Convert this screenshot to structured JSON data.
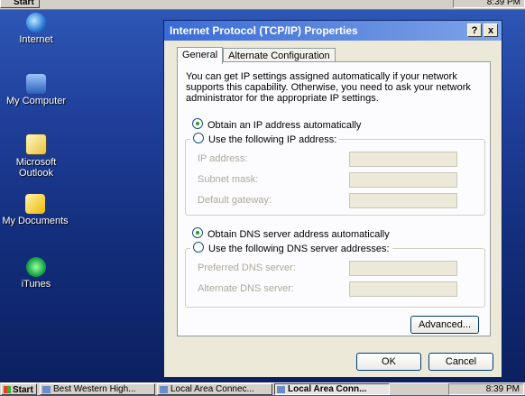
{
  "top_taskbar": {
    "start_label": "Start",
    "clock": "8:39 PM"
  },
  "desktop": {
    "icons": [
      {
        "label": "Internet"
      },
      {
        "label": "My Computer"
      },
      {
        "label": "Microsoft Outlook"
      },
      {
        "label": "My Documents"
      },
      {
        "label": "iTunes"
      }
    ]
  },
  "dialog": {
    "title": "Internet Protocol (TCP/IP) Properties",
    "help_button": "?",
    "close_button": "x",
    "tabs": [
      {
        "label": "General",
        "active": true
      },
      {
        "label": "Alternate Configuration",
        "active": false
      }
    ],
    "intro_text": "You can get IP settings assigned automatically if your network supports this capability. Otherwise, you need to ask your network administrator for the appropriate IP settings.",
    "ip": {
      "auto_label": "Obtain an IP address automatically",
      "auto_selected": true,
      "manual_label": "Use the following IP address:",
      "fields": [
        {
          "label": "IP address:",
          "value": ""
        },
        {
          "label": "Subnet mask:",
          "value": ""
        },
        {
          "label": "Default gateway:",
          "value": ""
        }
      ]
    },
    "dns": {
      "auto_label": "Obtain DNS server address automatically",
      "auto_selected": true,
      "manual_label": "Use the following DNS server addresses:",
      "fields": [
        {
          "label": "Preferred DNS server:",
          "value": ""
        },
        {
          "label": "Alternate DNS server:",
          "value": ""
        }
      ]
    },
    "advanced_button": "Advanced...",
    "ok_button": "OK",
    "cancel_button": "Cancel"
  },
  "taskbar": {
    "start_label": "Start",
    "tasks": [
      {
        "label": "Best Western High...",
        "active": false
      },
      {
        "label": "Local Area Connec...",
        "active": false
      },
      {
        "label": "Local Area Conn...",
        "active": true
      }
    ],
    "clock": "8:39 PM"
  }
}
